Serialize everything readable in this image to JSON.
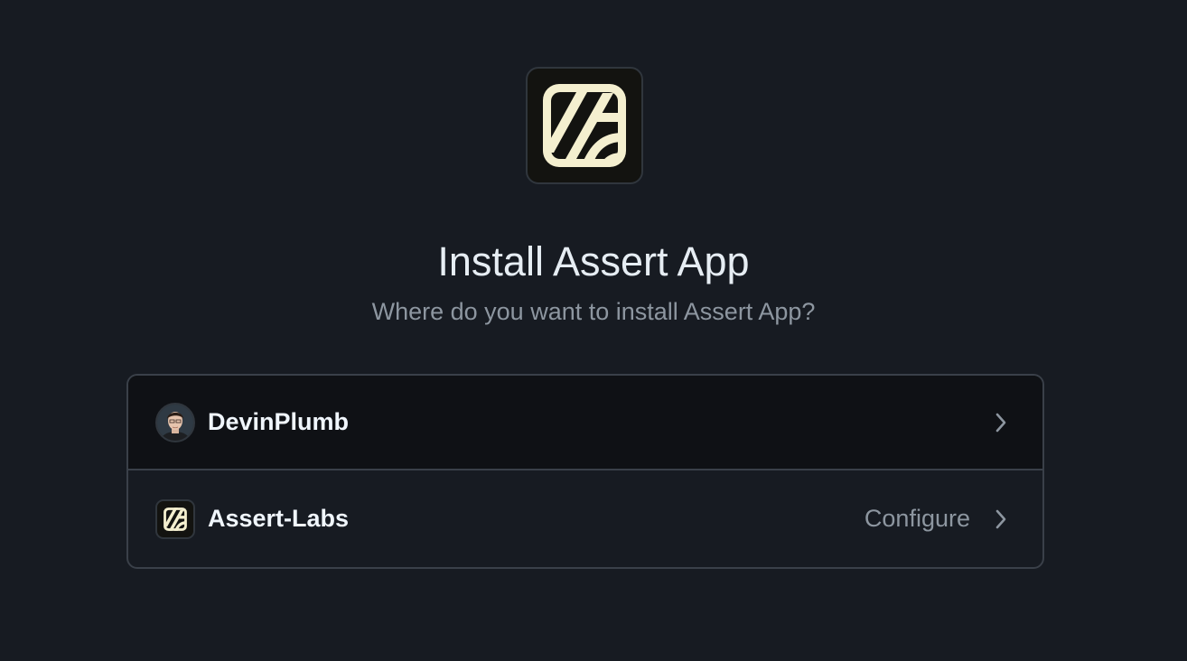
{
  "app": {
    "logo_icon": "assert-logo-icon",
    "title": "Install Assert App",
    "subtitle": "Where do you want to install Assert App?"
  },
  "accounts": [
    {
      "name": "DevinPlumb",
      "avatar_icon": "user-avatar",
      "action_label": "",
      "chevron_icon": "chevron-right-icon"
    },
    {
      "name": "Assert-Labs",
      "avatar_icon": "assert-logo-icon",
      "action_label": "Configure",
      "chevron_icon": "chevron-right-icon"
    }
  ],
  "colors": {
    "background": "#171b22",
    "selected_row": "#0f1115",
    "border": "#3a4049",
    "logo_cream": "#f4efcf",
    "muted_text": "#8d96a0"
  }
}
